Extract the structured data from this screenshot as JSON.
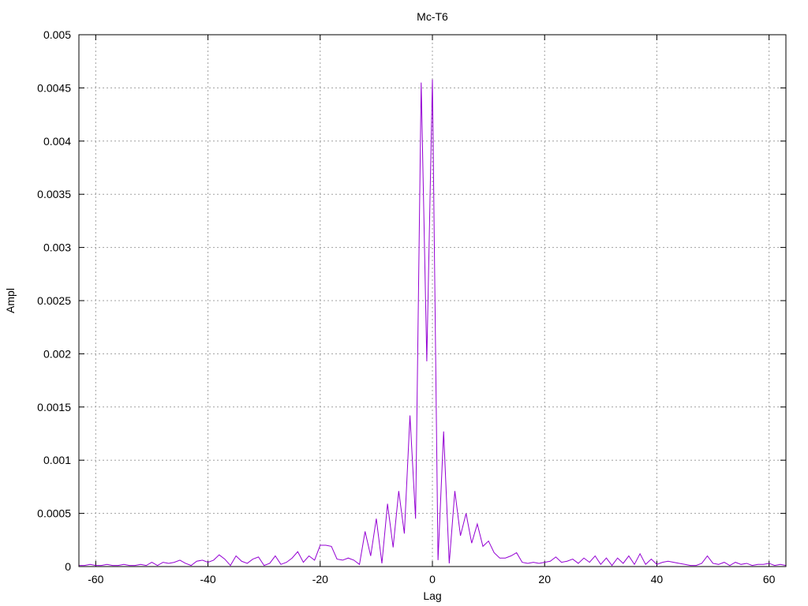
{
  "chart_data": {
    "type": "line",
    "title": "Mc-T6",
    "xlabel": "Lag",
    "ylabel": "Ampl",
    "xlim": [
      -63,
      63
    ],
    "ylim": [
      0,
      0.005
    ],
    "grid": true,
    "line_color": "#9400d3",
    "xticks": [
      {
        "value": -60,
        "label": "-60"
      },
      {
        "value": -40,
        "label": "-40"
      },
      {
        "value": -20,
        "label": "-20"
      },
      {
        "value": 0,
        "label": "0"
      },
      {
        "value": 20,
        "label": "20"
      },
      {
        "value": 40,
        "label": "40"
      },
      {
        "value": 60,
        "label": "60"
      }
    ],
    "yticks": [
      {
        "value": 0,
        "label": "0"
      },
      {
        "value": 0.0005,
        "label": "0.0005"
      },
      {
        "value": 0.001,
        "label": "0.001"
      },
      {
        "value": 0.0015,
        "label": "0.0015"
      },
      {
        "value": 0.002,
        "label": "0.002"
      },
      {
        "value": 0.0025,
        "label": "0.0025"
      },
      {
        "value": 0.003,
        "label": "0.003"
      },
      {
        "value": 0.0035,
        "label": "0.0035"
      },
      {
        "value": 0.004,
        "label": "0.004"
      },
      {
        "value": 0.0045,
        "label": "0.0045"
      },
      {
        "value": 0.005,
        "label": "0.005"
      }
    ],
    "series": [
      {
        "x": [
          -63,
          -62,
          -61,
          -60,
          -59,
          -58,
          -57,
          -56,
          -55,
          -54,
          -53,
          -52,
          -51,
          -50,
          -49,
          -48,
          -47,
          -46,
          -45,
          -44,
          -43,
          -42,
          -41,
          -40,
          -39,
          -38,
          -37,
          -36,
          -35,
          -34,
          -33,
          -32,
          -31,
          -30,
          -29,
          -28,
          -27,
          -26,
          -25,
          -24,
          -23,
          -22,
          -21,
          -20,
          -19,
          -18,
          -17,
          -16,
          -15,
          -14,
          -13,
          -12,
          -11,
          -10,
          -9,
          -8,
          -7,
          -6,
          -5,
          -4,
          -3,
          -2,
          -1,
          0,
          1,
          2,
          3,
          4,
          5,
          6,
          7,
          8,
          9,
          10,
          11,
          12,
          13,
          14,
          15,
          16,
          17,
          18,
          19,
          20,
          21,
          22,
          23,
          24,
          25,
          26,
          27,
          28,
          29,
          30,
          31,
          32,
          33,
          34,
          35,
          36,
          37,
          38,
          39,
          40,
          41,
          42,
          43,
          44,
          45,
          46,
          47,
          48,
          49,
          50,
          51,
          52,
          53,
          54,
          55,
          56,
          57,
          58,
          59,
          60,
          61,
          62,
          63
        ],
        "y": [
          1e-05,
          1e-05,
          2e-05,
          1e-05,
          1e-05,
          2e-05,
          1e-05,
          1e-05,
          2e-05,
          1e-05,
          1e-05,
          2e-05,
          1e-05,
          4e-05,
          1e-05,
          4e-05,
          3e-05,
          4e-05,
          6e-05,
          3e-05,
          1e-05,
          5e-05,
          6e-05,
          4e-05,
          6e-05,
          0.00011,
          7e-05,
          1e-05,
          0.0001,
          5e-05,
          3e-05,
          7e-05,
          9e-05,
          1e-05,
          3e-05,
          0.0001,
          2e-05,
          4e-05,
          8e-05,
          0.00014,
          4e-05,
          0.0001,
          6e-05,
          0.0002,
          0.0002,
          0.00019,
          7e-05,
          6e-05,
          8e-05,
          6e-05,
          2e-05,
          0.00033,
          0.0001,
          0.00045,
          3e-05,
          0.00059,
          0.00018,
          0.00071,
          0.00031,
          0.00142,
          0.00045,
          0.00455,
          0.00193,
          0.00458,
          6e-05,
          0.00127,
          3e-05,
          0.00071,
          0.00029,
          0.0005,
          0.00022,
          0.0004,
          0.00019,
          0.00024,
          0.00013,
          8e-05,
          8e-05,
          0.0001,
          0.00013,
          4e-05,
          3e-05,
          4e-05,
          3e-05,
          4e-05,
          5e-05,
          9e-05,
          4e-05,
          5e-05,
          7e-05,
          3e-05,
          8e-05,
          4e-05,
          0.0001,
          2e-05,
          8e-05,
          1e-05,
          8e-05,
          3e-05,
          0.0001,
          2e-05,
          0.00012,
          2e-05,
          7e-05,
          2e-05,
          4e-05,
          5e-05,
          4e-05,
          3e-05,
          2e-05,
          1e-05,
          1e-05,
          3e-05,
          0.0001,
          3e-05,
          2e-05,
          4e-05,
          1e-05,
          4e-05,
          2e-05,
          3e-05,
          1e-05,
          2e-05,
          2e-05,
          3e-05,
          1e-05,
          2e-05,
          1e-05
        ]
      }
    ]
  }
}
